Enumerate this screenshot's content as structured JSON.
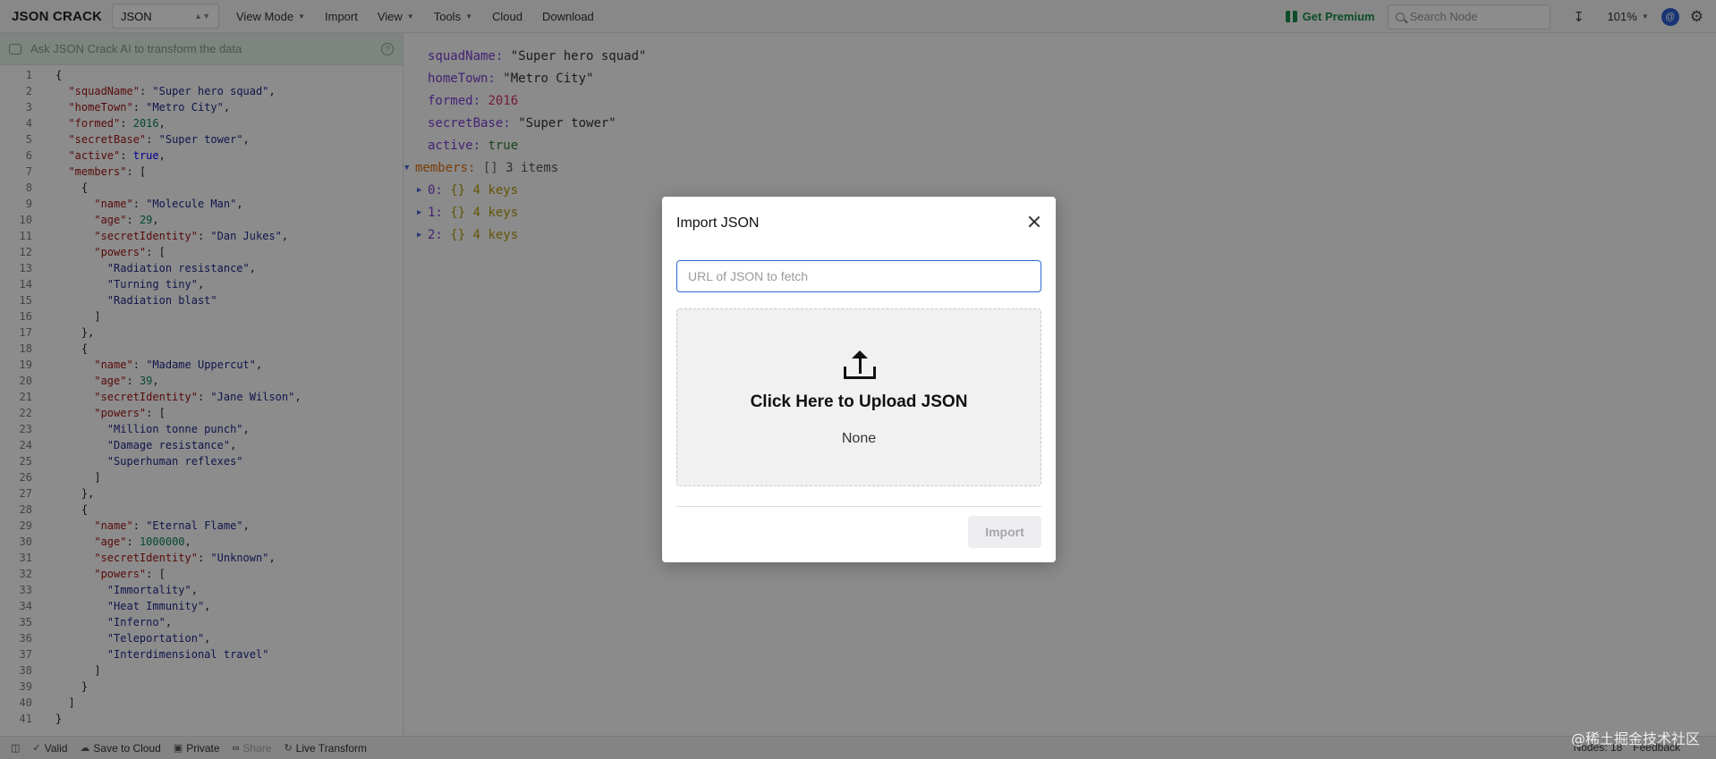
{
  "topbar": {
    "logo": "JSON CRACK",
    "format_select": "JSON",
    "menu": [
      "View Mode",
      "Import",
      "View",
      "Tools",
      "Cloud",
      "Download"
    ],
    "premium": "Get Premium",
    "search_placeholder": "Search Node",
    "zoom": "101%",
    "avatar_letter": "@"
  },
  "ai_bar": {
    "placeholder": "Ask JSON Crack AI to transform the data"
  },
  "editor": {
    "lines": [
      "{",
      "  \"squadName\": \"Super hero squad\",",
      "  \"homeTown\": \"Metro City\",",
      "  \"formed\": 2016,",
      "  \"secretBase\": \"Super tower\",",
      "  \"active\": true,",
      "  \"members\": [",
      "    {",
      "      \"name\": \"Molecule Man\",",
      "      \"age\": 29,",
      "      \"secretIdentity\": \"Dan Jukes\",",
      "      \"powers\": [",
      "        \"Radiation resistance\",",
      "        \"Turning tiny\",",
      "        \"Radiation blast\"",
      "      ]",
      "    },",
      "    {",
      "      \"name\": \"Madame Uppercut\",",
      "      \"age\": 39,",
      "      \"secretIdentity\": \"Jane Wilson\",",
      "      \"powers\": [",
      "        \"Million tonne punch\",",
      "        \"Damage resistance\",",
      "        \"Superhuman reflexes\"",
      "      ]",
      "    },",
      "    {",
      "      \"name\": \"Eternal Flame\",",
      "      \"age\": 1000000,",
      "      \"secretIdentity\": \"Unknown\",",
      "      \"powers\": [",
      "        \"Immortality\",",
      "        \"Heat Immunity\",",
      "        \"Inferno\",",
      "        \"Teleportation\",",
      "        \"Interdimensional travel\"",
      "      ]",
      "    }",
      "  ]",
      "}"
    ]
  },
  "tree": {
    "rows": [
      {
        "key": "squadName:",
        "value": "\"Super hero squad\"",
        "type": "str"
      },
      {
        "key": "homeTown:",
        "value": "\"Metro City\"",
        "type": "str"
      },
      {
        "key": "formed:",
        "value": "2016",
        "type": "num"
      },
      {
        "key": "secretBase:",
        "value": "\"Super tower\"",
        "type": "str"
      },
      {
        "key": "active:",
        "value": "true",
        "type": "bool"
      }
    ],
    "members": {
      "key": "members:",
      "bracket": "[]",
      "meta": "3 items"
    },
    "children": [
      {
        "key": "0:",
        "bracket": "{}",
        "meta": "4 keys"
      },
      {
        "key": "1:",
        "bracket": "{}",
        "meta": "4 keys"
      },
      {
        "key": "2:",
        "bracket": "{}",
        "meta": "4 keys"
      }
    ]
  },
  "modal": {
    "title": "Import JSON",
    "url_placeholder": "URL of JSON to fetch",
    "upload_title": "Click Here to Upload JSON",
    "file_name": "None",
    "import_button": "Import"
  },
  "statusbar": {
    "valid": "Valid",
    "save_cloud": "Save to Cloud",
    "private": "Private",
    "share": "Share",
    "live_transform": "Live Transform",
    "nodes": "Nodes: 18",
    "feedback": "Feedback"
  },
  "watermark": "@稀土掘金技术社区"
}
